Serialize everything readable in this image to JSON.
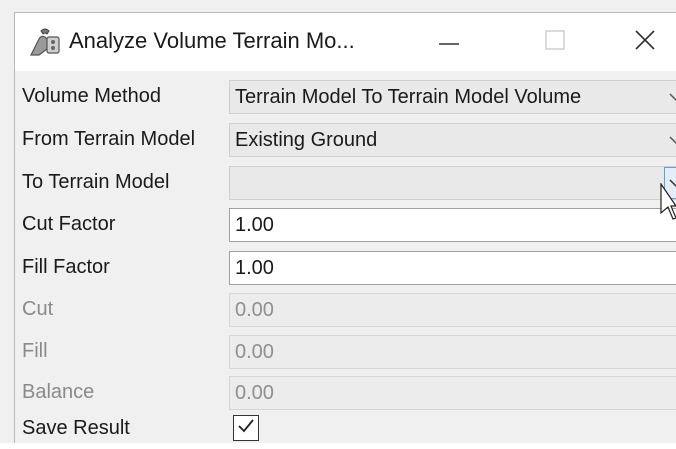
{
  "window": {
    "title": "Analyze Volume Terrain Mo..."
  },
  "fields": {
    "volume_method": {
      "label": "Volume Method",
      "value": "Terrain Model To Terrain Model Volume"
    },
    "from_terrain_model": {
      "label": "From Terrain Model",
      "value": "Existing Ground"
    },
    "to_terrain_model": {
      "label": "To Terrain Model",
      "value": ""
    },
    "cut_factor": {
      "label": "Cut Factor",
      "value": "1.00"
    },
    "fill_factor": {
      "label": "Fill Factor",
      "value": "1.00"
    },
    "cut": {
      "label": "Cut",
      "value": "0.00"
    },
    "fill": {
      "label": "Fill",
      "value": "0.00"
    },
    "balance": {
      "label": "Balance",
      "value": "0.00"
    },
    "save_result": {
      "label": "Save Result",
      "checked": true
    }
  },
  "icons": {
    "app": "terrain-tools-icon",
    "minimize": "minimize-icon",
    "maximize": "maximize-icon",
    "close": "close-icon",
    "dropdown": "chevron-down-icon",
    "checkbox": "checkmark-icon",
    "cursor": "mouse-pointer-icon"
  },
  "colors": {
    "dialog_background": "#f0f0f0",
    "title_background": "#ffffff",
    "dropdown_hover": "#6a9fd6",
    "disabled_text": "#8a8a8a"
  }
}
